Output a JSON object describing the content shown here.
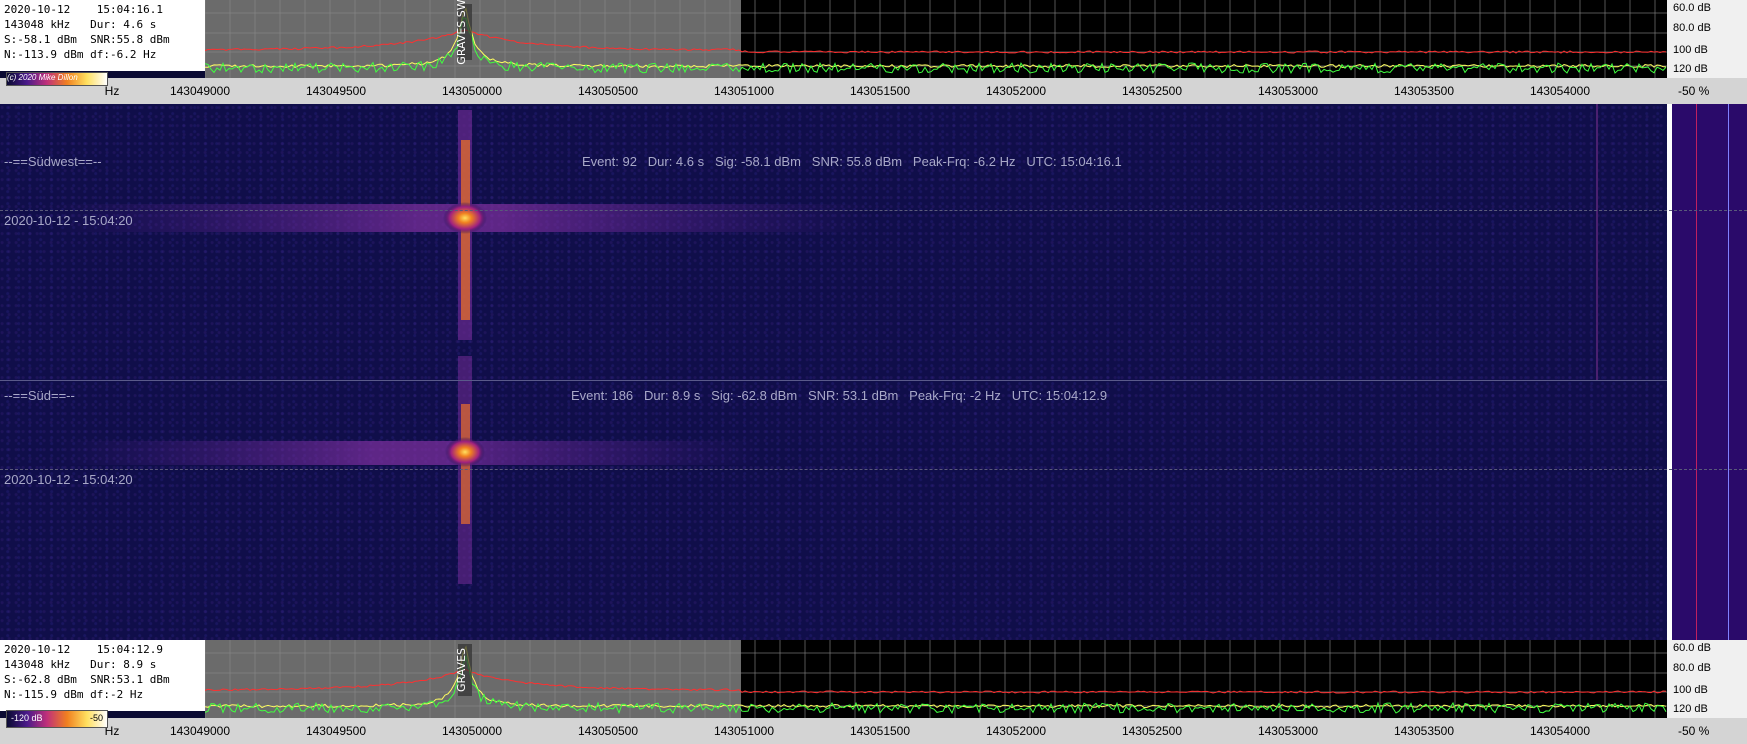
{
  "top_panel": {
    "date": "2020-10-12",
    "time": "15:04:16.1",
    "freq": "143048 kHz",
    "duration": "Dur: 4.6 s",
    "signal": "S:-58.1 dBm",
    "snr": "SNR:55.8 dBm",
    "noise": "N:-113.9 dBm",
    "df": "df:-6.2 Hz",
    "peak_label": "GRAVES SW",
    "copyright": "(c) 2020 Mike Dillon"
  },
  "bottom_panel": {
    "date": "2020-10-12",
    "time": "15:04:12.9",
    "freq": "143048 kHz",
    "duration": "Dur: 8.9 s",
    "signal": "S:-62.8 dBm",
    "snr": "SNR:53.1 dBm",
    "noise": "N:-115.9 dBm",
    "df": "df:-2 Hz",
    "peak_label": "GRAVES",
    "colorbar_min": "-120 dB",
    "colorbar_max": "-50"
  },
  "db_scale": [
    "60.0 dB",
    "80.0 dB",
    "100 dB",
    "120 dB"
  ],
  "freq_unit": "Hz",
  "freq_ticks": [
    "143049000",
    "143049500",
    "143050000",
    "143050500",
    "143051000",
    "143051500",
    "143052000",
    "143052500",
    "143053000",
    "143053500",
    "143054000"
  ],
  "percent": "-50 %",
  "channels": [
    {
      "name": "--==Südwest==--",
      "event": "Event: 92   Dur: 4.6 s   Sig: -58.1 dBm   SNR: 55.8 dBm   Peak-Frq: -6.2 Hz   UTC: 15:04:16.1",
      "timestamp": "2020-10-12 - 15:04:20"
    },
    {
      "name": "--==Süd==--",
      "event": "Event: 186   Dur: 8.9 s   Sig: -62.8 dBm   SNR: 53.1 dBm   Peak-Frq: -2 Hz   UTC: 15:04:12.9",
      "timestamp": "2020-10-12 - 15:04:20"
    }
  ],
  "colors": {
    "background": "#100e4a",
    "spectrum_green": "#40ff40",
    "spectrum_red": "#ff3030",
    "spectrum_yellow": "#ffff60",
    "signal_core": "#ffd060"
  }
}
